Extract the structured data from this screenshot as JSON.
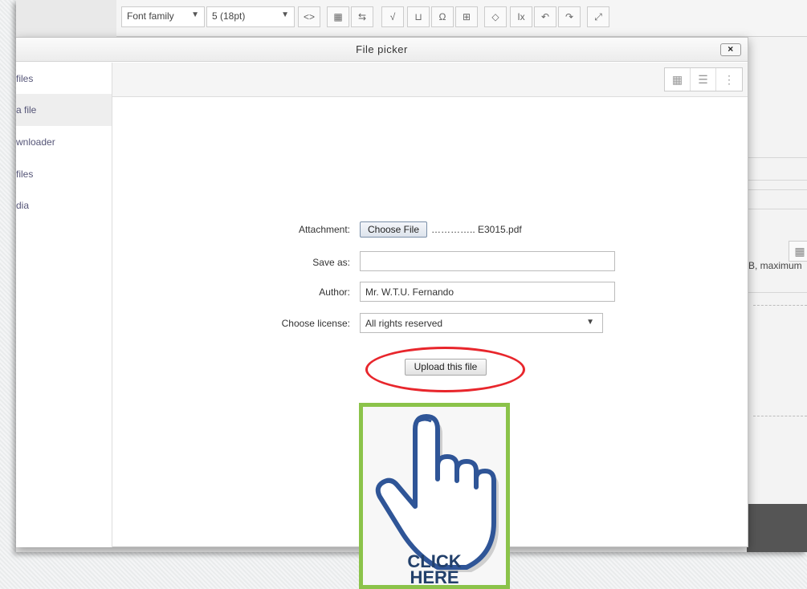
{
  "editor": {
    "font_family": "Font family",
    "font_size": "5 (18pt)",
    "max_text": "B, maximum"
  },
  "dialog": {
    "title": "File picker",
    "close": "×"
  },
  "sidebar": {
    "items": [
      {
        "label": "files",
        "active": false
      },
      {
        "label": "a file",
        "active": true
      },
      {
        "label": "wnloader",
        "active": false
      },
      {
        "label": "files",
        "active": false
      },
      {
        "label": "dia",
        "active": false
      }
    ]
  },
  "form": {
    "attachment_label": "Attachment:",
    "choose_file_label": "Choose File",
    "file_name": "………….. E3015.pdf",
    "save_as_label": "Save as:",
    "save_as_value": "",
    "author_label": "Author:",
    "author_value": "Mr. W.T.U. Fernando",
    "license_label": "Choose license:",
    "license_value": "All rights reserved",
    "upload_label": "Upload this file"
  },
  "overlay": {
    "click_line1": "CLICK",
    "click_line2": "HERE",
    "ellipse_color": "#e8262c",
    "frame_color": "#8bc34a",
    "hand_color": "#2f5597"
  },
  "icons": [
    "close-icon",
    "icon-view-icon",
    "list-view-icon",
    "tree-view-icon",
    "dropdown-arrow-icon",
    "pointing-hand-icon"
  ]
}
